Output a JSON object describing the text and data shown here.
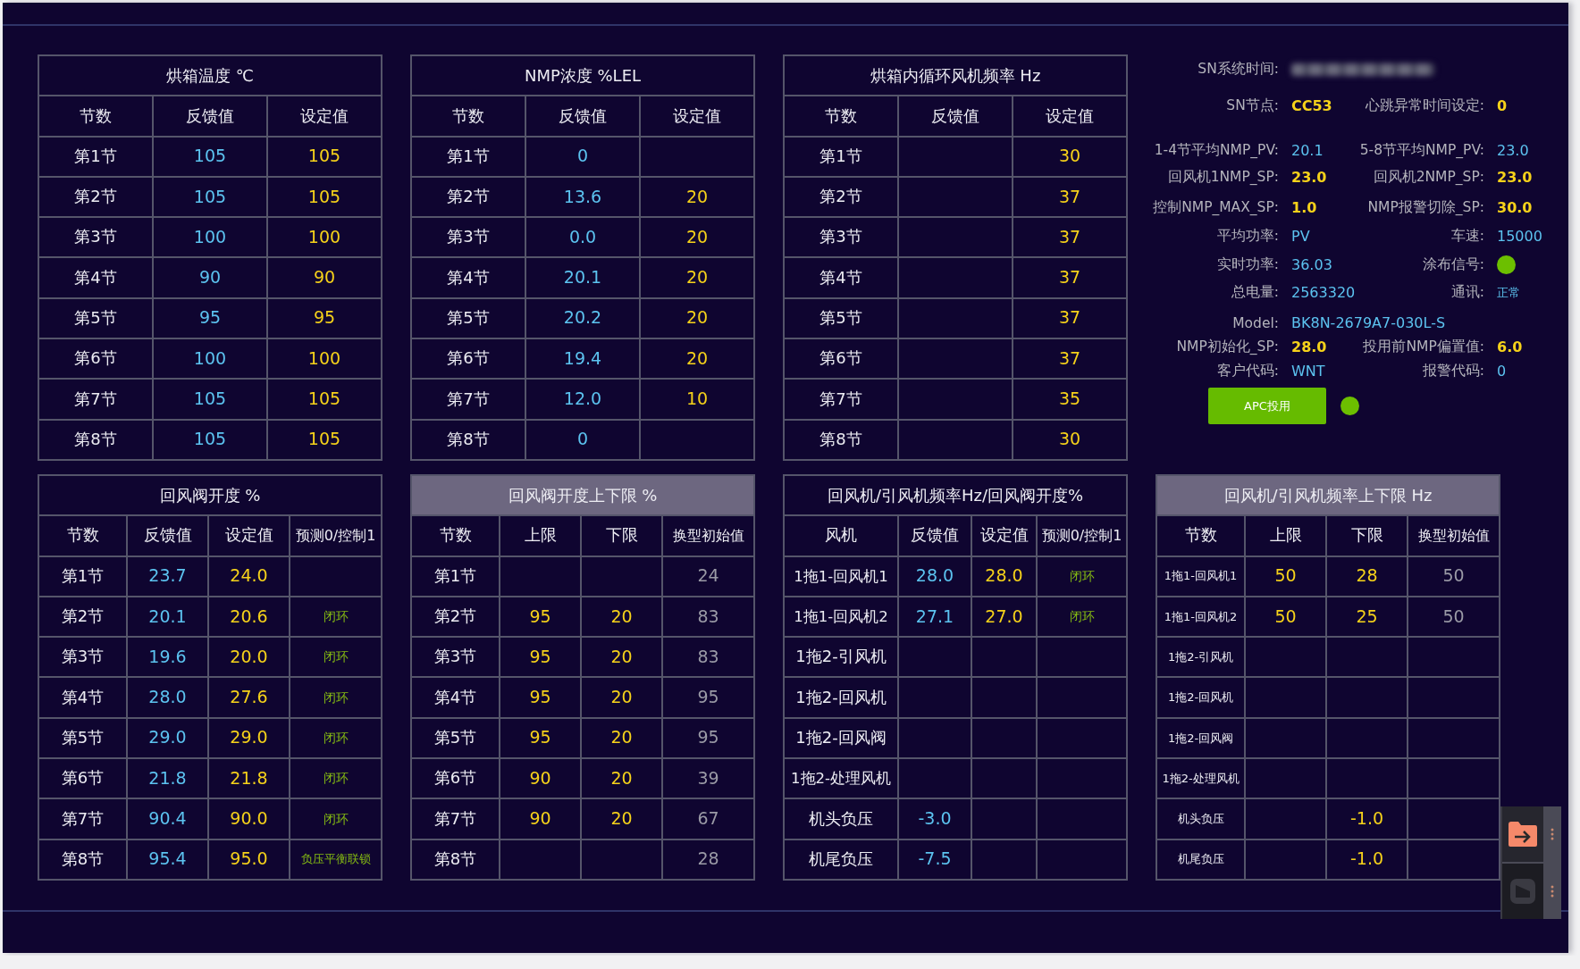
{
  "top_tables": [
    {
      "title": "烘箱温度 ℃",
      "shaded": false,
      "compact": false,
      "columns": [
        {
          "label": "节数",
          "kind": "label"
        },
        {
          "label": "反馈值",
          "kind": "feedback"
        },
        {
          "label": "设定值",
          "kind": "setpoint"
        }
      ],
      "rows": [
        [
          "第1节",
          "105",
          "105"
        ],
        [
          "第2节",
          "105",
          "105"
        ],
        [
          "第3节",
          "100",
          "100"
        ],
        [
          "第4节",
          "90",
          "90"
        ],
        [
          "第5节",
          "95",
          "95"
        ],
        [
          "第6节",
          "100",
          "100"
        ],
        [
          "第7节",
          "105",
          "105"
        ],
        [
          "第8节",
          "105",
          "105"
        ]
      ]
    },
    {
      "title": "NMP浓度 %LEL",
      "shaded": false,
      "compact": false,
      "columns": [
        {
          "label": "节数",
          "kind": "label"
        },
        {
          "label": "反馈值",
          "kind": "feedback"
        },
        {
          "label": "设定值",
          "kind": "setpoint"
        }
      ],
      "rows": [
        [
          "第1节",
          "0",
          null
        ],
        [
          "第2节",
          "13.6",
          "20"
        ],
        [
          "第3节",
          "0.0",
          "20"
        ],
        [
          "第4节",
          "20.1",
          "20"
        ],
        [
          "第5节",
          "20.2",
          "20"
        ],
        [
          "第6节",
          "19.4",
          "20"
        ],
        [
          "第7节",
          "12.0",
          "10"
        ],
        [
          "第8节",
          "0",
          null
        ]
      ]
    },
    {
      "title": "烘箱内循环风机频率 Hz",
      "shaded": false,
      "compact": false,
      "columns": [
        {
          "label": "节数",
          "kind": "label"
        },
        {
          "label": "反馈值",
          "kind": "feedback"
        },
        {
          "label": "设定值",
          "kind": "setpoint"
        }
      ],
      "rows": [
        [
          "第1节",
          null,
          "30"
        ],
        [
          "第2节",
          null,
          "37"
        ],
        [
          "第3节",
          null,
          "37"
        ],
        [
          "第4节",
          null,
          "37"
        ],
        [
          "第5节",
          null,
          "37"
        ],
        [
          "第6节",
          null,
          "37"
        ],
        [
          "第7节",
          null,
          "35"
        ],
        [
          "第8节",
          null,
          "30"
        ]
      ]
    }
  ],
  "info_panel": {
    "rows": [
      [
        {
          "label": "SN系统时间:",
          "kind": "blurred"
        }
      ],
      [
        {
          "label": "SN节点:",
          "kind": "setpoint",
          "value": "CC53"
        },
        {
          "label": "心跳异常时间设定:",
          "kind": "setpoint",
          "value": "0"
        }
      ],
      [
        {
          "label": "1-4节平均NMP_PV:",
          "kind": "feedback",
          "value": "20.1"
        },
        {
          "label": "5-8节平均NMP_PV:",
          "kind": "feedback",
          "value": "23.0"
        }
      ],
      [
        {
          "label": "回风机1NMP_SP:",
          "kind": "setpoint",
          "value": "23.0"
        },
        {
          "label": "回风机2NMP_SP:",
          "kind": "setpoint",
          "value": "23.0"
        }
      ],
      [
        {
          "label": "控制NMP_MAX_SP:",
          "kind": "setpoint",
          "value": "1.0"
        },
        {
          "label": "NMP报警切除_SP:",
          "kind": "setpoint",
          "value": "30.0"
        }
      ],
      [
        {
          "label": "平均功率:",
          "kind": "feedback",
          "value": "PV"
        },
        {
          "label": "车速:",
          "kind": "feedback",
          "value": "15000"
        }
      ],
      [
        {
          "label": "实时功率:",
          "kind": "feedback",
          "value": "36.03"
        },
        {
          "label": "涂布信号:",
          "kind": "lamp",
          "color": "#6cbf00"
        }
      ],
      [
        {
          "label": "总电量:",
          "kind": "feedback",
          "value": "2563320"
        },
        {
          "label": "通讯:",
          "kind": "status",
          "value": "正常"
        }
      ],
      [
        {
          "label": "Model:",
          "kind": "feedback",
          "value": "BK8N-2679A7-030L-S"
        }
      ],
      [
        {
          "label": "NMP初始化_SP:",
          "kind": "setpoint",
          "value": "28.0"
        },
        {
          "label": "投用前NMP偏置值:",
          "kind": "setpoint",
          "value": "6.0"
        }
      ],
      [
        {
          "label": "客户代码:",
          "kind": "feedback",
          "value": "WNT"
        },
        {
          "label": "报警代码:",
          "kind": "feedback",
          "value": "0"
        }
      ]
    ],
    "button": {
      "label": "APC投用"
    },
    "apc_lamp": {
      "color": "#6cbf00"
    }
  },
  "bottom_tables": [
    {
      "title": "回风阀开度 %",
      "shaded": false,
      "compact": false,
      "columns": [
        {
          "label": "节数",
          "kind": "label"
        },
        {
          "label": "反馈值",
          "kind": "feedback"
        },
        {
          "label": "设定值",
          "kind": "setpoint"
        },
        {
          "label": "预测0/控制1",
          "kind": "mode"
        }
      ],
      "rows": [
        [
          "第1节",
          "23.7",
          "24.0",
          null
        ],
        [
          "第2节",
          "20.1",
          "20.6",
          "闭环"
        ],
        [
          "第3节",
          "19.6",
          "20.0",
          "闭环"
        ],
        [
          "第4节",
          "28.0",
          "27.6",
          "闭环"
        ],
        [
          "第5节",
          "29.0",
          "29.0",
          "闭环"
        ],
        [
          "第6节",
          "21.8",
          "21.8",
          "闭环"
        ],
        [
          "第7节",
          "90.4",
          "90.0",
          "闭环"
        ],
        [
          "第8节",
          "95.4",
          "95.0",
          "负压平衡联锁"
        ]
      ]
    },
    {
      "title": "回风阀开度上下限 %",
      "shaded": true,
      "compact": false,
      "columns": [
        {
          "label": "节数",
          "kind": "label"
        },
        {
          "label": "上限",
          "kind": "setpoint"
        },
        {
          "label": "下限",
          "kind": "setpoint"
        },
        {
          "label": "换型初始值",
          "kind": "initial"
        }
      ],
      "rows": [
        [
          "第1节",
          null,
          null,
          "24"
        ],
        [
          "第2节",
          "95",
          "20",
          "83"
        ],
        [
          "第3节",
          "95",
          "20",
          "83"
        ],
        [
          "第4节",
          "95",
          "20",
          "95"
        ],
        [
          "第5节",
          "95",
          "20",
          "95"
        ],
        [
          "第6节",
          "90",
          "20",
          "39"
        ],
        [
          "第7节",
          "90",
          "20",
          "67"
        ],
        [
          "第8节",
          null,
          null,
          "28"
        ]
      ]
    },
    {
      "title": "回风机/引风机频率Hz/回风阀开度%",
      "shaded": false,
      "compact": false,
      "columns": [
        {
          "label": "风机",
          "kind": "label"
        },
        {
          "label": "反馈值",
          "kind": "feedback"
        },
        {
          "label": "设定值",
          "kind": "setpoint"
        },
        {
          "label": "预测0/控制1",
          "kind": "mode"
        }
      ],
      "rows": [
        [
          "1拖1-回风机1",
          "28.0",
          "28.0",
          "闭环"
        ],
        [
          "1拖1-回风机2",
          "27.1",
          "27.0",
          "闭环"
        ],
        [
          "1拖2-引风机",
          null,
          null,
          null
        ],
        [
          "1拖2-回风机",
          null,
          null,
          null
        ],
        [
          "1拖2-回风阀",
          null,
          null,
          null
        ],
        [
          "1拖2-处理风机",
          null,
          null,
          null
        ],
        [
          "机头负压",
          "-3.0",
          null,
          null
        ],
        [
          "机尾负压",
          "-7.5",
          null,
          null
        ]
      ]
    },
    {
      "title": "回风机/引风机频率上下限 Hz",
      "shaded": true,
      "compact": true,
      "columns": [
        {
          "label": "节数",
          "kind": "label"
        },
        {
          "label": "上限",
          "kind": "setpoint"
        },
        {
          "label": "下限",
          "kind": "setpoint"
        },
        {
          "label": "换型初始值",
          "kind": "initial"
        }
      ],
      "rows": [
        [
          "1拖1-回风机1",
          "50",
          "28",
          "50"
        ],
        [
          "1拖1-回风机2",
          "50",
          "25",
          "50"
        ],
        [
          "1拖2-引风机",
          null,
          null,
          null
        ],
        [
          "1拖2-回风机",
          null,
          null,
          null
        ],
        [
          "1拖2-回风阀",
          null,
          null,
          null
        ],
        [
          "1拖2-处理风机",
          null,
          null,
          null
        ],
        [
          "机头负压",
          null,
          "-1.0",
          null
        ],
        [
          "机尾负压",
          null,
          "-1.0",
          null
        ]
      ]
    }
  ]
}
